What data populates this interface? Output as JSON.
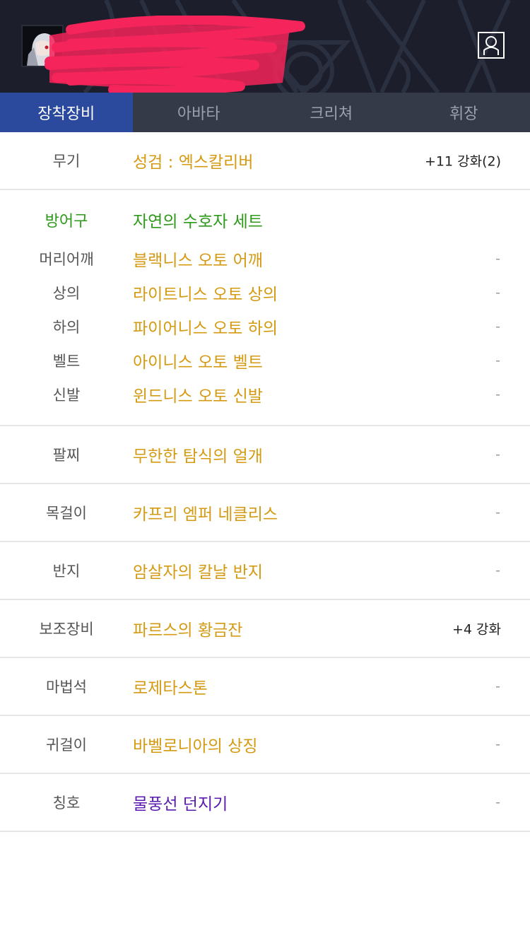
{
  "tabs": [
    {
      "label": "장착장비",
      "active": true
    },
    {
      "label": "아바타",
      "active": false
    },
    {
      "label": "크리쳐",
      "active": false
    },
    {
      "label": "휘장",
      "active": false
    }
  ],
  "header": {
    "profile_icon": "profile-icon",
    "background_color": "#1c1f2b"
  },
  "colors": {
    "item_name": "#d49a12",
    "set_name": "#2e9a1a",
    "title_name": "#5a19b0",
    "active_tab": "#2b4a9e",
    "tab_bar": "#343a48"
  },
  "weapon": {
    "label": "무기",
    "name": "성검 : 엑스칼리버",
    "value": "+11 강화(2)"
  },
  "armor": {
    "label": "방어구",
    "set_name": "자연의 수호자 세트",
    "items": [
      {
        "label": "머리어깨",
        "name": "블랙니스 오토 어깨",
        "value": "-"
      },
      {
        "label": "상의",
        "name": "라이트니스 오토 상의",
        "value": "-"
      },
      {
        "label": "하의",
        "name": "파이어니스 오토 하의",
        "value": "-"
      },
      {
        "label": "벨트",
        "name": "아이니스 오토 벨트",
        "value": "-"
      },
      {
        "label": "신발",
        "name": "윈드니스 오토 신발",
        "value": "-"
      }
    ]
  },
  "accessories": [
    {
      "label": "팔찌",
      "name": "무한한 탐식의 얼개",
      "value": "-"
    },
    {
      "label": "목걸이",
      "name": "카프리 엠퍼 네클리스",
      "value": "-"
    },
    {
      "label": "반지",
      "name": "암살자의 칼날 반지",
      "value": "-"
    },
    {
      "label": "보조장비",
      "name": "파르스의 황금잔",
      "value": "+4 강화"
    },
    {
      "label": "마법석",
      "name": "로제타스톤",
      "value": "-"
    },
    {
      "label": "귀걸이",
      "name": "바벨로니아의 상징",
      "value": "-"
    },
    {
      "label": "칭호",
      "name": "물풍선 던지기",
      "value": "-"
    }
  ]
}
